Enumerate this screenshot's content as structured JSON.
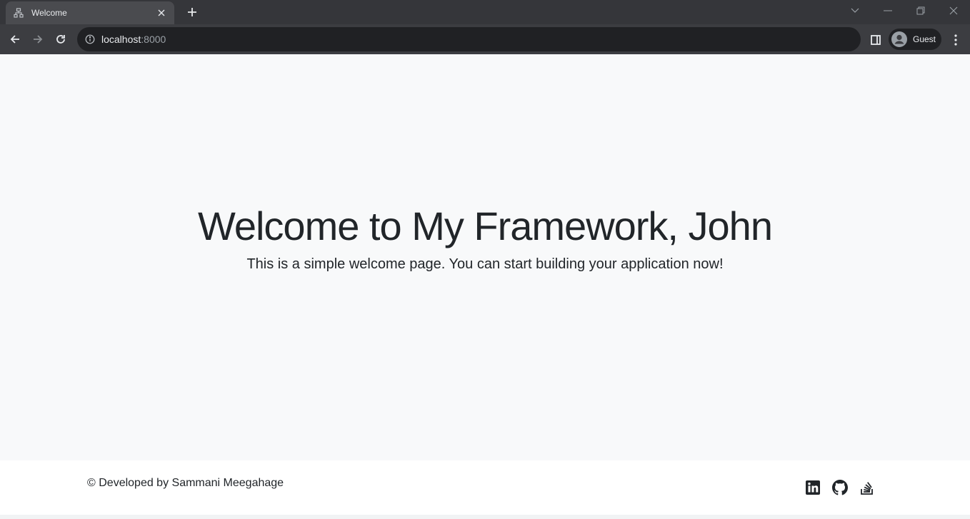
{
  "browser": {
    "tab": {
      "title": "Welcome",
      "favicon": "sitemap-icon"
    },
    "address": {
      "host": "localhost",
      "port": ":8000"
    },
    "profile": {
      "label": "Guest"
    }
  },
  "page": {
    "title": "Welcome to My Framework, John",
    "subtitle": "This is a simple welcome page. You can start building your application now!"
  },
  "footer": {
    "copyright": "© Developed by Sammani Meegahage",
    "social": [
      "linkedin-icon",
      "github-icon",
      "stackoverflow-icon"
    ]
  },
  "colors": {
    "chrome_dark": "#35363a",
    "omnibox": "#202124",
    "page_bg": "#f8f9fa",
    "text": "#212529"
  }
}
